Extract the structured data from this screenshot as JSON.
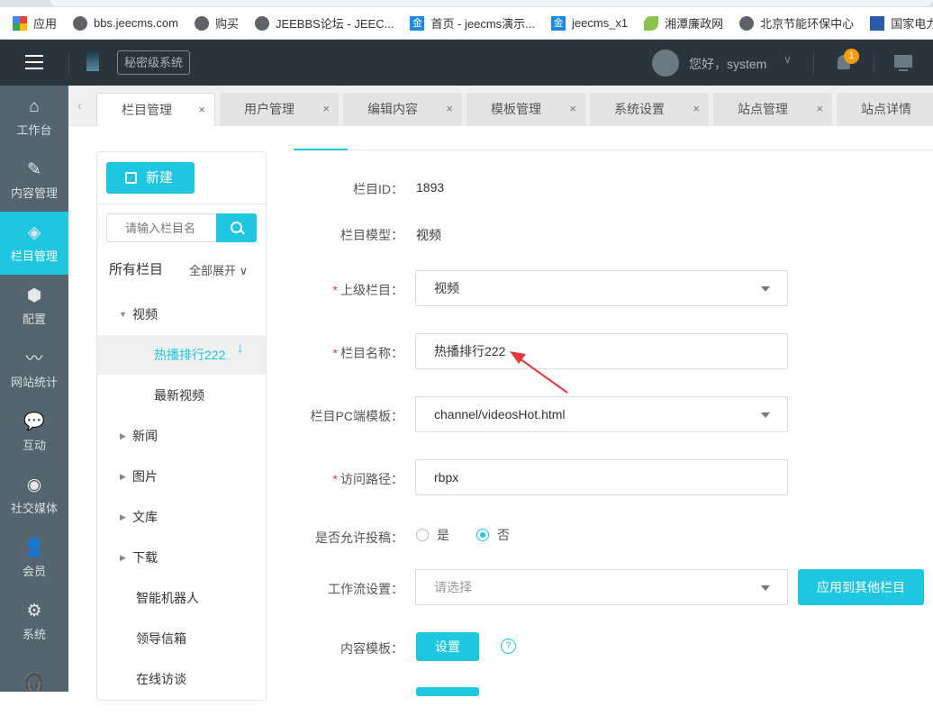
{
  "bookmarks": [
    {
      "label": "应用",
      "icon": "apps-grid-icon"
    },
    {
      "label": "bbs.jeecms.com",
      "icon": "globe-icon"
    },
    {
      "label": "购买",
      "icon": "globe-icon"
    },
    {
      "label": "JEEBBS论坛 - JEEC...",
      "icon": "globe-icon"
    },
    {
      "label": "首页 - jeecms演示...",
      "icon": "jeecms-icon"
    },
    {
      "label": "jeecms_x1",
      "icon": "jeecms-icon"
    },
    {
      "label": "湘潭廉政网",
      "icon": "leaf-icon"
    },
    {
      "label": "北京节能环保中心",
      "icon": "globe-icon"
    },
    {
      "label": "国家电力规划研究...",
      "icon": "flag-icon"
    }
  ],
  "header": {
    "system_badge": "秘密级系统",
    "greeting": "您好，system",
    "notification_count": "1"
  },
  "sidebar": {
    "items": [
      {
        "label": "工作台",
        "icon": "⌂"
      },
      {
        "label": "内容管理",
        "icon": "✎"
      },
      {
        "label": "栏目管理",
        "icon": "◈",
        "active": true
      },
      {
        "label": "配置",
        "icon": "⬢"
      },
      {
        "label": "网站统计",
        "icon": "〰"
      },
      {
        "label": "互动",
        "icon": "💬"
      },
      {
        "label": "社交媒体",
        "icon": "◉"
      },
      {
        "label": "会员",
        "icon": "👤"
      },
      {
        "label": "系统",
        "icon": "⚙"
      },
      {
        "label": "",
        "icon": "🎧"
      }
    ]
  },
  "tabs": [
    {
      "label": "栏目管理",
      "active": true
    },
    {
      "label": "用户管理"
    },
    {
      "label": "编辑内容"
    },
    {
      "label": "模板管理"
    },
    {
      "label": "系统设置"
    },
    {
      "label": "站点管理"
    },
    {
      "label": "站点详情"
    }
  ],
  "tab_close": "×",
  "tree": {
    "new_label": "新建",
    "search_placeholder": "请输入栏目名",
    "title": "所有栏目",
    "expand_all": "全部展开",
    "nodes": [
      {
        "label": "视频"
      },
      {
        "label": "热播排行222"
      },
      {
        "label": "最新视频"
      },
      {
        "label": "新闻"
      },
      {
        "label": "图片"
      },
      {
        "label": "文库"
      },
      {
        "label": "下载"
      },
      {
        "label": "智能机器人"
      },
      {
        "label": "领导信箱"
      },
      {
        "label": "在线访谈"
      }
    ]
  },
  "form": {
    "id_label": "栏目ID：",
    "id_value": "1893",
    "model_label": "栏目模型：",
    "model_value": "视频",
    "parent_label": "上级栏目：",
    "parent_value": "视频",
    "name_label": "栏目名称：",
    "name_value": "热播排行222",
    "pc_tpl_label": "栏目PC端模板：",
    "pc_tpl_value": "channel/videosHot.html",
    "path_label": "访问路径：",
    "path_value": "rbpx",
    "contrib_label": "是否允许投稿：",
    "contrib_yes": "是",
    "contrib_no": "否",
    "workflow_label": "工作流设置：",
    "workflow_placeholder": "请选择",
    "apply_other": "应用到其他栏目",
    "content_tpl_label": "内容模板：",
    "set_label": "设置",
    "help": "?",
    "required": "*"
  }
}
